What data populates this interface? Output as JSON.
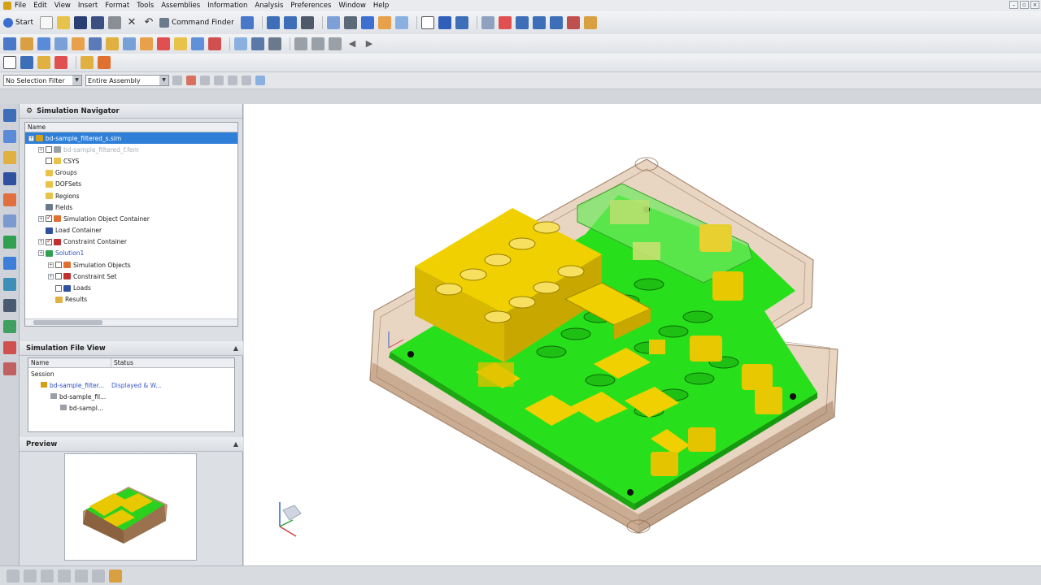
{
  "menu": {
    "items": [
      "File",
      "Edit",
      "View",
      "Insert",
      "Format",
      "Tools",
      "Assemblies",
      "Information",
      "Analysis",
      "Preferences",
      "Window",
      "Help"
    ],
    "underline": [
      "F",
      "E",
      "V",
      "I",
      "o",
      "T",
      "A",
      "I",
      "n",
      "P",
      "W",
      "H"
    ]
  },
  "toolbar": {
    "start_label": "Start",
    "command_finder_label": "Command Finder"
  },
  "filterbar": {
    "selection_filter": "No Selection Filter",
    "scope": "Entire Assembly"
  },
  "navigator": {
    "title": "Simulation Navigator",
    "column_name": "Name",
    "items": [
      {
        "label": "bd-sample_filtered_s.sim",
        "level": 0,
        "selected": true,
        "icon": "sim-icon"
      },
      {
        "label": "bd-sample_filtered_f.fem",
        "level": 1,
        "dimmed": true,
        "icon": "fem-icon"
      },
      {
        "label": "CSYS",
        "level": 1,
        "icon": "folder-icon"
      },
      {
        "label": "Groups",
        "level": 1,
        "icon": "folder-icon"
      },
      {
        "label": "DOFSets",
        "level": 1,
        "icon": "folder-icon"
      },
      {
        "label": "Regions",
        "level": 1,
        "icon": "folder-icon"
      },
      {
        "label": "Fields",
        "level": 1,
        "icon": "fields-icon"
      },
      {
        "label": "Simulation Object Container",
        "level": 1,
        "icon": "sim-object-icon"
      },
      {
        "label": "Load Container",
        "level": 1,
        "icon": "load-icon"
      },
      {
        "label": "Constraint Container",
        "level": 1,
        "icon": "constraint-icon"
      },
      {
        "label": "Solution1",
        "level": 1,
        "icon": "solution-icon",
        "blue": true
      },
      {
        "label": "Simulation Objects",
        "level": 2,
        "icon": "sim-object-icon"
      },
      {
        "label": "Constraint Set",
        "level": 2,
        "icon": "constraint-icon"
      },
      {
        "label": "Loads",
        "level": 2,
        "icon": "load-icon"
      },
      {
        "label": "Results",
        "level": 2,
        "icon": "results-icon"
      }
    ]
  },
  "fileview": {
    "title": "Simulation File View",
    "col_name": "Name",
    "col_status": "Status",
    "rows": [
      {
        "name": "Session",
        "status": "",
        "level": 0
      },
      {
        "name": "bd-sample_filter...",
        "status": "Displayed & W...",
        "level": 1
      },
      {
        "name": "bd-sample_fil...",
        "status": "",
        "level": 2
      },
      {
        "name": "bd-sampl...",
        "status": "",
        "level": 3
      }
    ]
  },
  "preview": {
    "title": "Preview"
  },
  "colors": {
    "board_green": "#27e01b",
    "component_yellow": "#f0d000",
    "enclosure": "#c89a6e",
    "selection_blue": "#2f7fd8"
  }
}
